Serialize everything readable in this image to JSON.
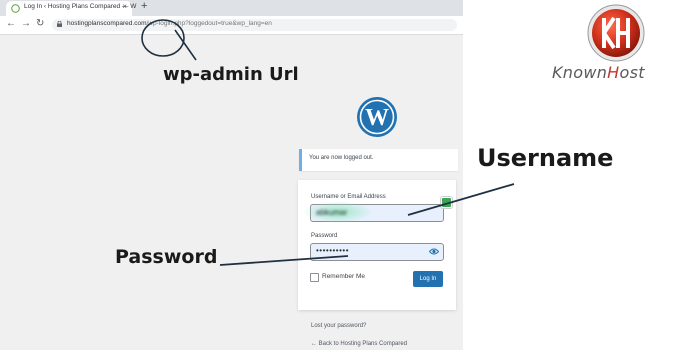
{
  "browser": {
    "tab_title": "Log In ‹ Hosting Plans Compared — W",
    "tab_close": "×",
    "new_tab": "+",
    "url_host": "hostingplanscompared.com",
    "url_path": "/wp-login.php?loggedout=true&wp_lang=en",
    "nav_back": "←",
    "nav_forward": "→",
    "nav_reload": "↻"
  },
  "annotations": {
    "wpadmin": "wp-admin Url",
    "username": "Username",
    "password": "Password"
  },
  "notice": "You are now logged out.",
  "login": {
    "username_label": "Username or Email Address",
    "username_value": "abkumar",
    "password_label": "Password",
    "password_dots": "••••••••••",
    "remember_label": "Remember Me",
    "login_button": "Log In"
  },
  "links": {
    "lost_password": "Lost your password?",
    "back_to_site": "← Back to Hosting Plans Compared"
  },
  "brand": {
    "logo_text_a": "Known",
    "logo_text_b": "H",
    "logo_text_c": "ost",
    "accent": "#c0392b",
    "wp_blue": "#2271b1"
  }
}
